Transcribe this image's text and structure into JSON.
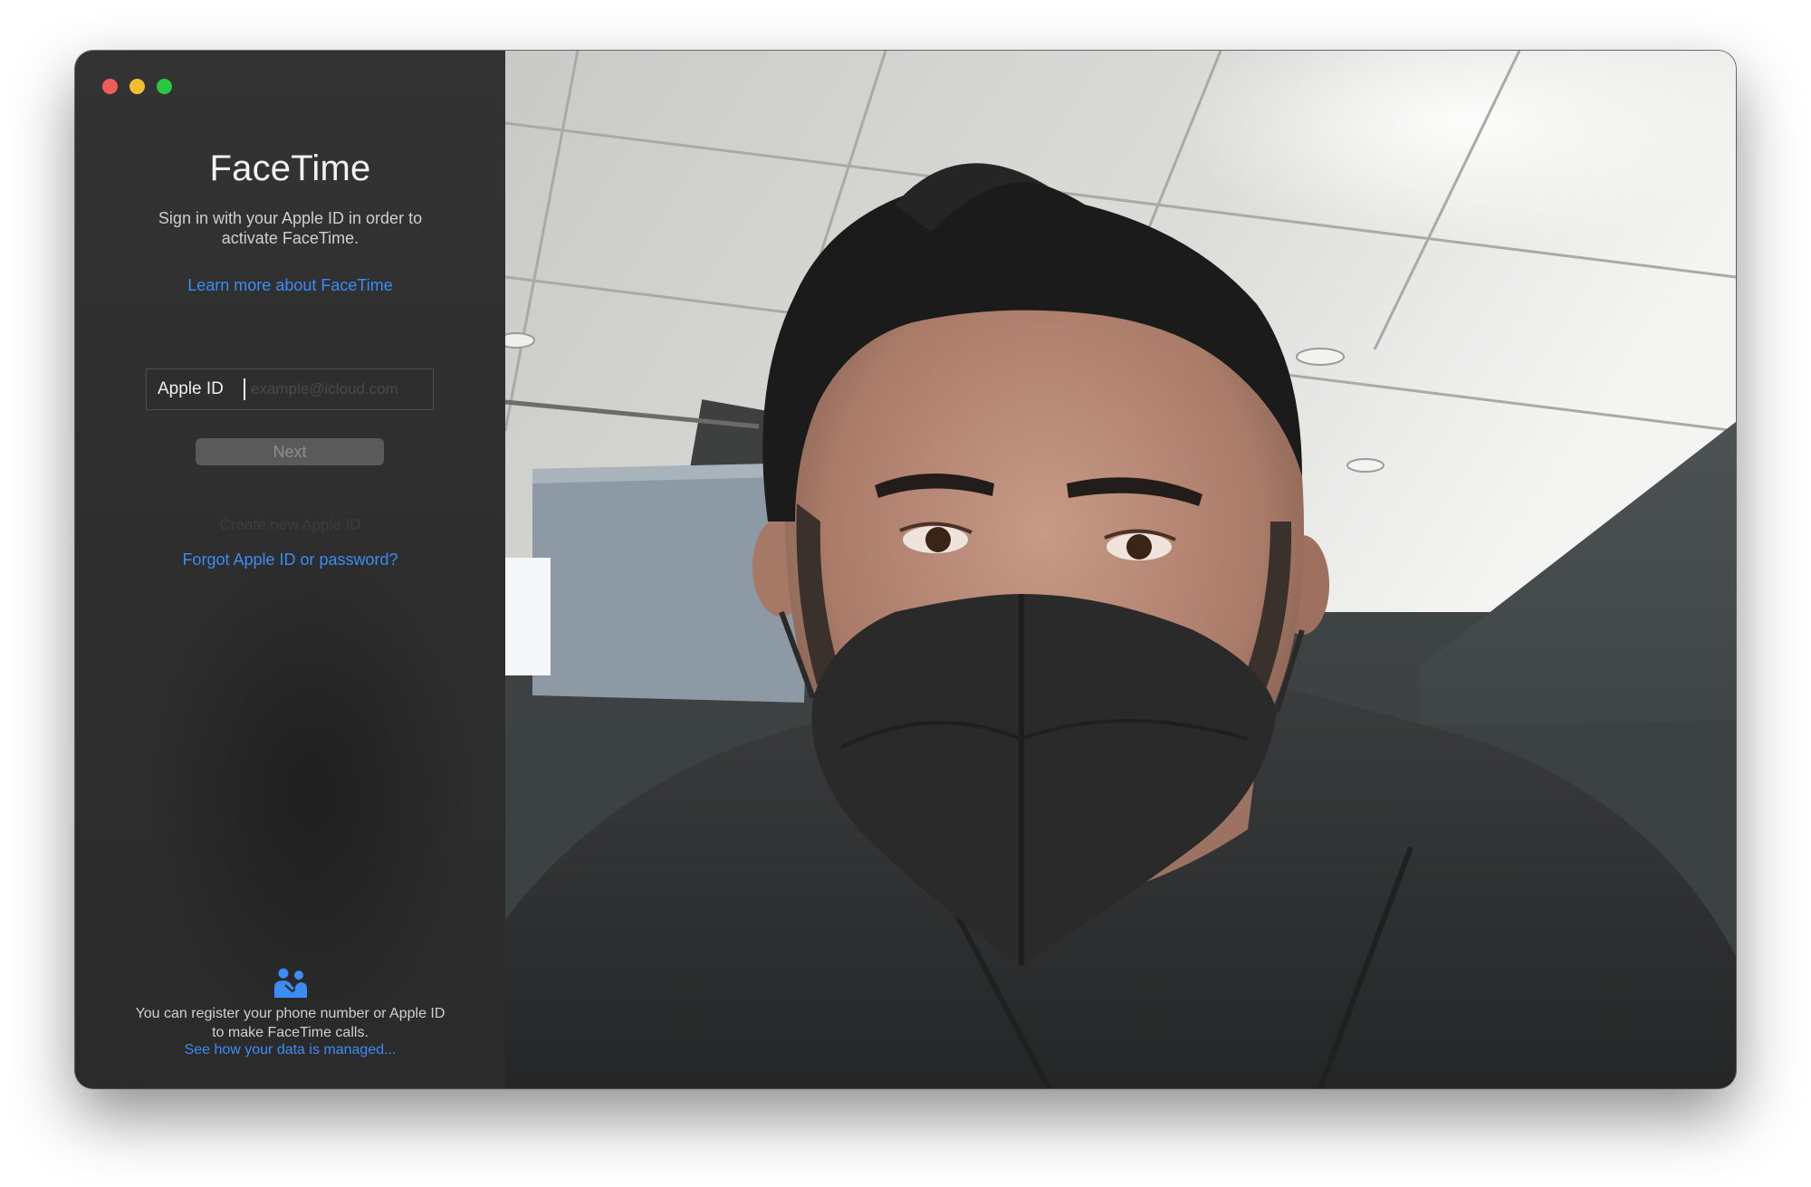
{
  "window": {
    "controls": [
      "close",
      "minimize",
      "zoom"
    ]
  },
  "sidebar": {
    "title": "FaceTime",
    "subtitle": "Sign in with your Apple ID in order to activate FaceTime.",
    "learn_more_link": "Learn more about FaceTime",
    "apple_id_label": "Apple ID",
    "apple_id_value": "",
    "apple_id_placeholder": "example@icloud.com",
    "next_button": "Next",
    "create_link": "Create new Apple ID",
    "forgot_link": "Forgot Apple ID or password?",
    "footer_icon": "people-icon",
    "footer_text": "You can register your phone number or Apple ID to make FaceTime calls.",
    "footer_link": "See how your data is managed..."
  },
  "colors": {
    "link": "#3b8cf5",
    "close": "#ee5e56",
    "minimize": "#f6bc2f",
    "zoom": "#2cc740"
  },
  "camera": {
    "content": "camera-preview-image"
  }
}
